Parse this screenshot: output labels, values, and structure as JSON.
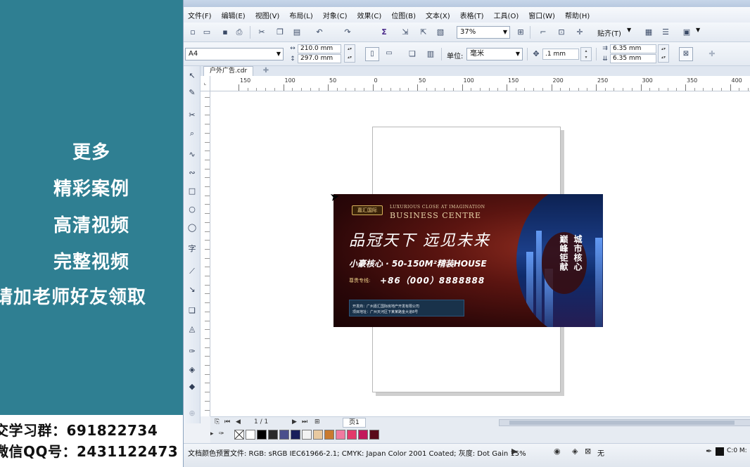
{
  "promo": {
    "lines": [
      "更多",
      "精彩案例",
      "高清视频",
      "完整视频",
      "请加老师好友领取"
    ],
    "group_label": "交学习群：691822734",
    "qq_label": "微信QQ号：2431122473"
  },
  "menu": [
    "文件(F)",
    "编辑(E)",
    "视图(V)",
    "布局(L)",
    "对象(C)",
    "效果(C)",
    "位图(B)",
    "文本(X)",
    "表格(T)",
    "工具(O)",
    "窗口(W)",
    "帮助(H)"
  ],
  "standard_toolbar": {
    "zoom": "37%",
    "snap_label": "贴齐(T)"
  },
  "property_bar": {
    "page_size": "A4",
    "width": "210.0 mm",
    "height": "297.0 mm",
    "unit_label": "单位:",
    "unit": "毫米",
    "nudge": ".1 mm",
    "dup_x": "6.35 mm",
    "dup_y": "6.35 mm"
  },
  "document": {
    "tab": "户外广告.cdr"
  },
  "ruler": {
    "labels": [
      "150",
      "100",
      "50",
      "0",
      "50",
      "100",
      "150",
      "200",
      "250",
      "300",
      "350",
      "400"
    ]
  },
  "artwork": {
    "logo": "嘉汇国际",
    "tagline": "LUXURIOUS CLOSE AT IMAGINATION",
    "title": "BUSINESS CENTRE",
    "slogan": "品冠天下 远见未来",
    "subline": "小豪核心 · 50-150M²精装HOUSE",
    "hotline_label": "尊贵专线:",
    "hotline": "+86（000）8888888",
    "info_1": "开发商：广州嘉汇国际房地产开发有限公司",
    "info_2": "项目地址：广州天河区下某某路金大道8号",
    "city_col_1": "城市核心",
    "city_col_2": "巅峰钜献"
  },
  "page_nav": {
    "counter": "1 / 1",
    "page_tab": "页1"
  },
  "palette": [
    "#ffffff",
    "#000000",
    "#2a2a2a",
    "#4a4f8c",
    "#1a1f5a",
    "#f2f2f2",
    "#e8c9a0",
    "#c97a2e",
    "#f07aa0",
    "#e33a6a",
    "#c2185b",
    "#5a0a1a"
  ],
  "status": {
    "color_profile": "文档颜色预置文件: RGB: sRGB IEC61966-2.1; CMYK: Japan Color 2001 Coated; 灰度: Dot Gain 15%",
    "fill": "无",
    "cmyk": "C:0 M:"
  }
}
